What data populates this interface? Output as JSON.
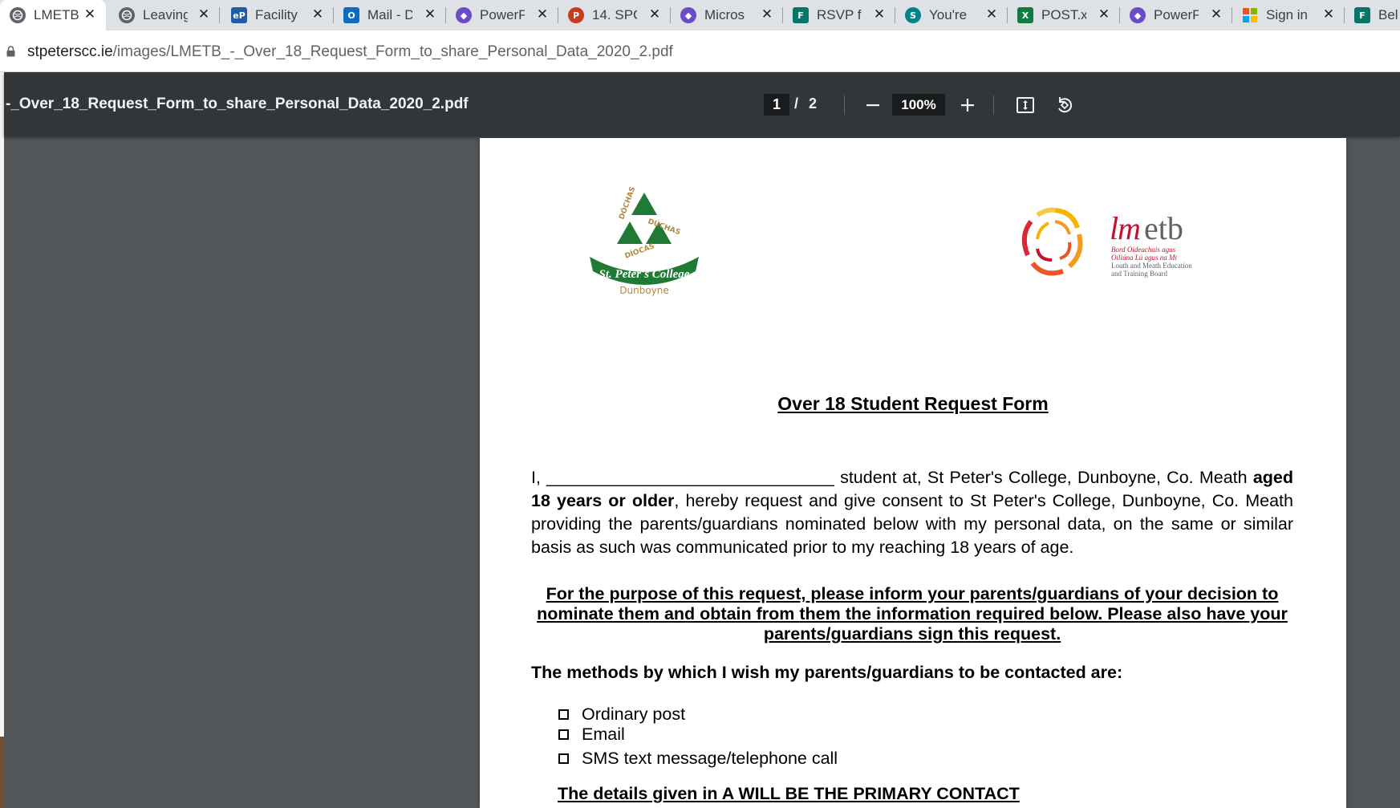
{
  "tabs": [
    {
      "label": "LMETB_",
      "active": true,
      "icon": "globe-icon"
    },
    {
      "label": "Leaving",
      "active": false,
      "icon": "globe-icon"
    },
    {
      "label": "Facility",
      "active": false,
      "icon": "eportal-icon"
    },
    {
      "label": "Mail - D",
      "active": false,
      "icon": "outlook-icon"
    },
    {
      "label": "PowerP",
      "active": false,
      "icon": "power-apps-icon"
    },
    {
      "label": "14. SPC",
      "active": false,
      "icon": "powerpoint-icon"
    },
    {
      "label": "Micros",
      "active": false,
      "icon": "power-apps-icon"
    },
    {
      "label": "RSVP fo",
      "active": false,
      "icon": "forms-icon"
    },
    {
      "label": "You're",
      "active": false,
      "icon": "sharepoint-icon"
    },
    {
      "label": "POST.x",
      "active": false,
      "icon": "excel-icon"
    },
    {
      "label": "PowerP",
      "active": false,
      "icon": "power-apps-icon"
    },
    {
      "label": "Sign in",
      "active": false,
      "icon": "microsoft-icon"
    },
    {
      "label": "Bel",
      "active": false,
      "icon": "forms-icon"
    }
  ],
  "address_bar": {
    "host": "stpeterscc.ie",
    "path": "/images/LMETB_-_Over_18_Request_Form_to_share_Personal_Data_2020_2.pdf"
  },
  "pdf_toolbar": {
    "title": "-_Over_18_Request_Form_to_share_Personal_Data_2020_2.pdf",
    "current_page": "1",
    "page_separator": "/",
    "total_pages": "2",
    "zoom": "100%"
  },
  "document": {
    "logo_left": {
      "text": "DÓCHAS",
      "name": "St. Peter's College",
      "town": "Dunboyne"
    },
    "logo_right": {
      "brand": "lmetb",
      "line1": "Bord Oideachais agus",
      "line2": "Oiliúna Lú agus na Mí",
      "line3": "Louth and Meath Education",
      "line4": "and Training Board"
    },
    "title": "Over 18 Student Request Form",
    "intro_start": "I, ______________________________ student at, St Peter's College, Dunboyne, Co. Meath ",
    "intro_bold": "aged 18 years or older",
    "intro_end": ", hereby request and give consent to St Peter's College, Dunboyne, Co. Meath providing the parents/guardians nominated below with my personal data, on the same or similar basis as such was communicated prior to my reaching 18 years of age.",
    "purpose": "For the purpose of this request, please inform your parents/guardians of your decision to nominate them and obtain from them the information required below. Please also have your parents/guardians sign this request.",
    "methods_heading": "The methods by which I wish my parents/guardians to be contacted are:",
    "options": [
      "Ordinary post",
      "Email",
      "SMS text message/telephone call"
    ],
    "primary_contact": "The details given in A WILL BE THE PRIMARY CONTACT"
  },
  "colors": {
    "spc_green": "#1e7a34",
    "spc_gold": "#b08a3e",
    "lmetb_red": "#c8102e"
  }
}
